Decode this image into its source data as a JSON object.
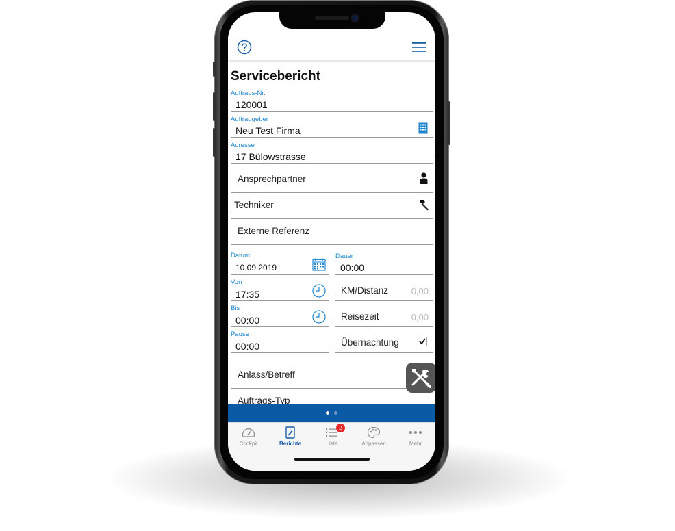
{
  "page": {
    "title": "Servicebericht"
  },
  "fields": {
    "auftragsnr": {
      "label": "Auftrags-Nr.",
      "value": "120001"
    },
    "auftraggeber": {
      "label": "Auftraggeber",
      "value": "Neu Test Firma",
      "icon": "building-icon"
    },
    "adresse": {
      "label": "Adresse",
      "value": "17 Bülowstrasse"
    },
    "ansprechpartner": {
      "placeholder": "Ansprechpartner",
      "icon": "person-icon"
    },
    "techniker": {
      "placeholder": "Techniker",
      "icon": "hammer-icon"
    },
    "externe_referenz": {
      "placeholder": "Externe Referenz"
    },
    "datum": {
      "label": "Datum",
      "value": "10.09.2019",
      "icon": "calendar-icon"
    },
    "dauer": {
      "label": "Dauer",
      "value": "00:00"
    },
    "von": {
      "label": "Von",
      "value": "17:35",
      "icon": "clock-icon"
    },
    "km_distanz": {
      "placeholder": "KM/Distanz",
      "value": "0,00"
    },
    "bis": {
      "label": "Bis",
      "value": "00:00",
      "icon": "clock-icon"
    },
    "reisezeit": {
      "placeholder": "Reisezeit",
      "value": "0,00"
    },
    "pause": {
      "label": "Pause",
      "value": "00:00"
    },
    "uebernachtung": {
      "label": "Übernachtung",
      "checked": true
    },
    "anlass_betreff": {
      "placeholder": "Anlass/Betreff"
    },
    "auftrags_typ": {
      "placeholder": "Auftrags-Typ"
    }
  },
  "tabs": [
    {
      "label": "Cockpit",
      "icon": "gauge-icon",
      "active": false
    },
    {
      "label": "Berichte",
      "icon": "document-edit-icon",
      "active": true
    },
    {
      "label": "Liste",
      "icon": "list-icon",
      "active": false,
      "badge": "2"
    },
    {
      "label": "Anpassen",
      "icon": "palette-icon",
      "active": false
    },
    {
      "label": "Mehr",
      "icon": "more-dots-icon",
      "active": false
    }
  ],
  "pager": {
    "pages": 2,
    "current": 1
  },
  "colors": {
    "accent": "#1c86d1",
    "bar": "#0a5aa6",
    "badge": "#e62a2a",
    "active_tab": "#1a5ea9"
  }
}
